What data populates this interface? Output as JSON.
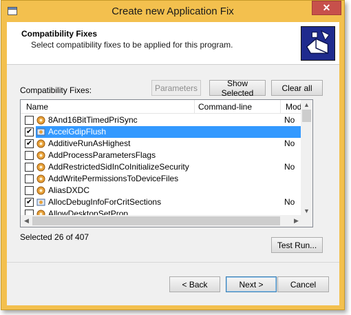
{
  "window": {
    "title": "Create new Application Fix",
    "close_glyph": "✕"
  },
  "header": {
    "title": "Compatibility Fixes",
    "subtitle": "Select compatibility fixes to be applied for this program."
  },
  "fixes_label": "Compatibility Fixes:",
  "toolbar": {
    "parameters_label": "Parameters",
    "show_selected_label": "Show Selected",
    "clear_all_label": "Clear all"
  },
  "list": {
    "columns": [
      "Name",
      "Command-line",
      "Module"
    ],
    "rows": [
      {
        "name": "8And16BitTimedPriSync",
        "checked": false,
        "module": "No",
        "selected": false
      },
      {
        "name": "AccelGdipFlush",
        "checked": true,
        "module": "",
        "selected": true
      },
      {
        "name": "AdditiveRunAsHighest",
        "checked": true,
        "module": "No",
        "selected": false
      },
      {
        "name": "AddProcessParametersFlags",
        "checked": false,
        "module": "",
        "selected": false
      },
      {
        "name": "AddRestrictedSidInCoInitializeSecurity",
        "checked": false,
        "module": "No",
        "selected": false
      },
      {
        "name": "AddWritePermissionsToDeviceFiles",
        "checked": false,
        "module": "",
        "selected": false
      },
      {
        "name": "AliasDXDC",
        "checked": false,
        "module": "",
        "selected": false
      },
      {
        "name": "AllocDebugInfoForCritSections",
        "checked": true,
        "module": "No",
        "selected": false
      },
      {
        "name": "AllowDesktopSetProp",
        "checked": false,
        "module": "",
        "selected": false
      }
    ]
  },
  "status": {
    "selected_text": "Selected 26 of 407"
  },
  "test_run_label": "Test Run...",
  "footer": {
    "back_label": "< Back",
    "next_label": "Next >",
    "cancel_label": "Cancel"
  },
  "icons": {
    "check": "✔",
    "scroll_up": "▲",
    "scroll_down": "▼",
    "scroll_left": "◀",
    "scroll_right": "▶"
  },
  "colors": {
    "window_frame": "#f3c04e",
    "selection": "#3399ff",
    "close_button": "#c7504b",
    "header_graphic": "#1f2b8e"
  }
}
